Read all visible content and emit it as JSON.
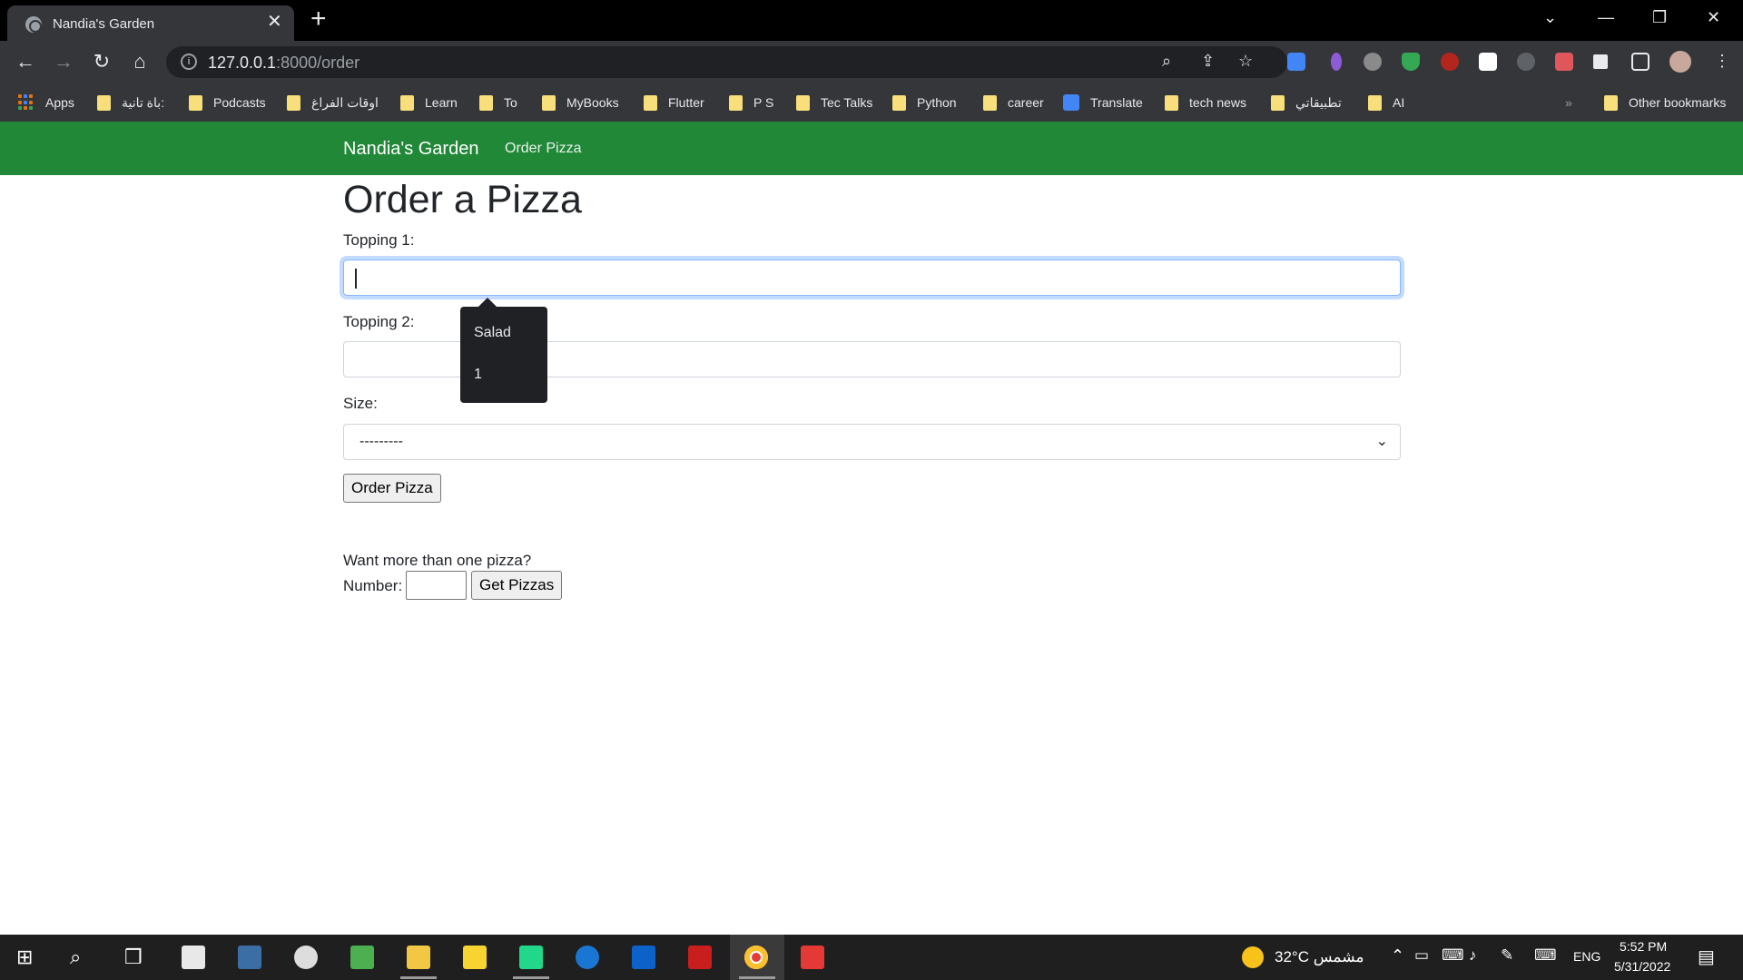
{
  "browser": {
    "tab_title": "Nandia's Garden",
    "close_glyph": "✕",
    "new_tab_glyph": "+",
    "window_controls": {
      "tabsearch": "⌄",
      "minimize": "—",
      "restore": "❐",
      "close": "✕"
    },
    "nav": {
      "back": "←",
      "forward": "→",
      "reload": "↻",
      "home": "⌂"
    },
    "url_host": "127.0.0.1",
    "url_rest": ":8000/order",
    "omnibox_icons": {
      "info": "i",
      "zoom": "⌕",
      "share": "⇪",
      "star": "☆"
    },
    "bookmarks": [
      {
        "label": "Apps",
        "icon": "apps-grid-icon"
      },
      {
        "label": "باة تانية:",
        "icon": "folder-icon"
      },
      {
        "label": "Podcasts",
        "icon": "folder-icon"
      },
      {
        "label": "اوقات الفراغ",
        "icon": "folder-icon"
      },
      {
        "label": "Learn",
        "icon": "folder-icon"
      },
      {
        "label": "To",
        "icon": "folder-icon"
      },
      {
        "label": "MyBooks",
        "icon": "folder-icon"
      },
      {
        "label": "Flutter",
        "icon": "folder-icon"
      },
      {
        "label": "P S",
        "icon": "folder-icon"
      },
      {
        "label": "Tec Talks",
        "icon": "folder-icon"
      },
      {
        "label": "Python",
        "icon": "folder-icon"
      },
      {
        "label": "career",
        "icon": "folder-icon"
      },
      {
        "label": "Translate",
        "icon": "google-translate-icon"
      },
      {
        "label": "tech news",
        "icon": "folder-icon"
      },
      {
        "label": "تطبيقاتي",
        "icon": "folder-icon"
      },
      {
        "label": "AI",
        "icon": "folder-icon"
      }
    ],
    "more_bookmarks_glyph": "»",
    "other_bookmarks": "Other bookmarks"
  },
  "site": {
    "brand": "Nandia's Garden",
    "nav_link": "Order Pizza"
  },
  "form": {
    "heading": "Order a Pizza",
    "topping1_label": "Topping 1:",
    "topping1_value": "",
    "topping2_label": "Topping 2:",
    "topping2_value": "",
    "size_label": "Size:",
    "size_selected": "---------",
    "size_chevron": "⌄",
    "submit_label": "Order Pizza",
    "autocomplete_options": [
      "Salad",
      "1"
    ]
  },
  "multi": {
    "prompt": "Want more than one pizza?",
    "number_label": "Number:",
    "number_value": "",
    "submit_label": "Get Pizzas"
  },
  "taskbar": {
    "weather": "32°C  مشمس",
    "language": "ENG",
    "time": "5:52 PM",
    "date": "5/31/2022",
    "colors": {
      "bg": "#1f1f1f",
      "navbar": "#218838"
    }
  }
}
